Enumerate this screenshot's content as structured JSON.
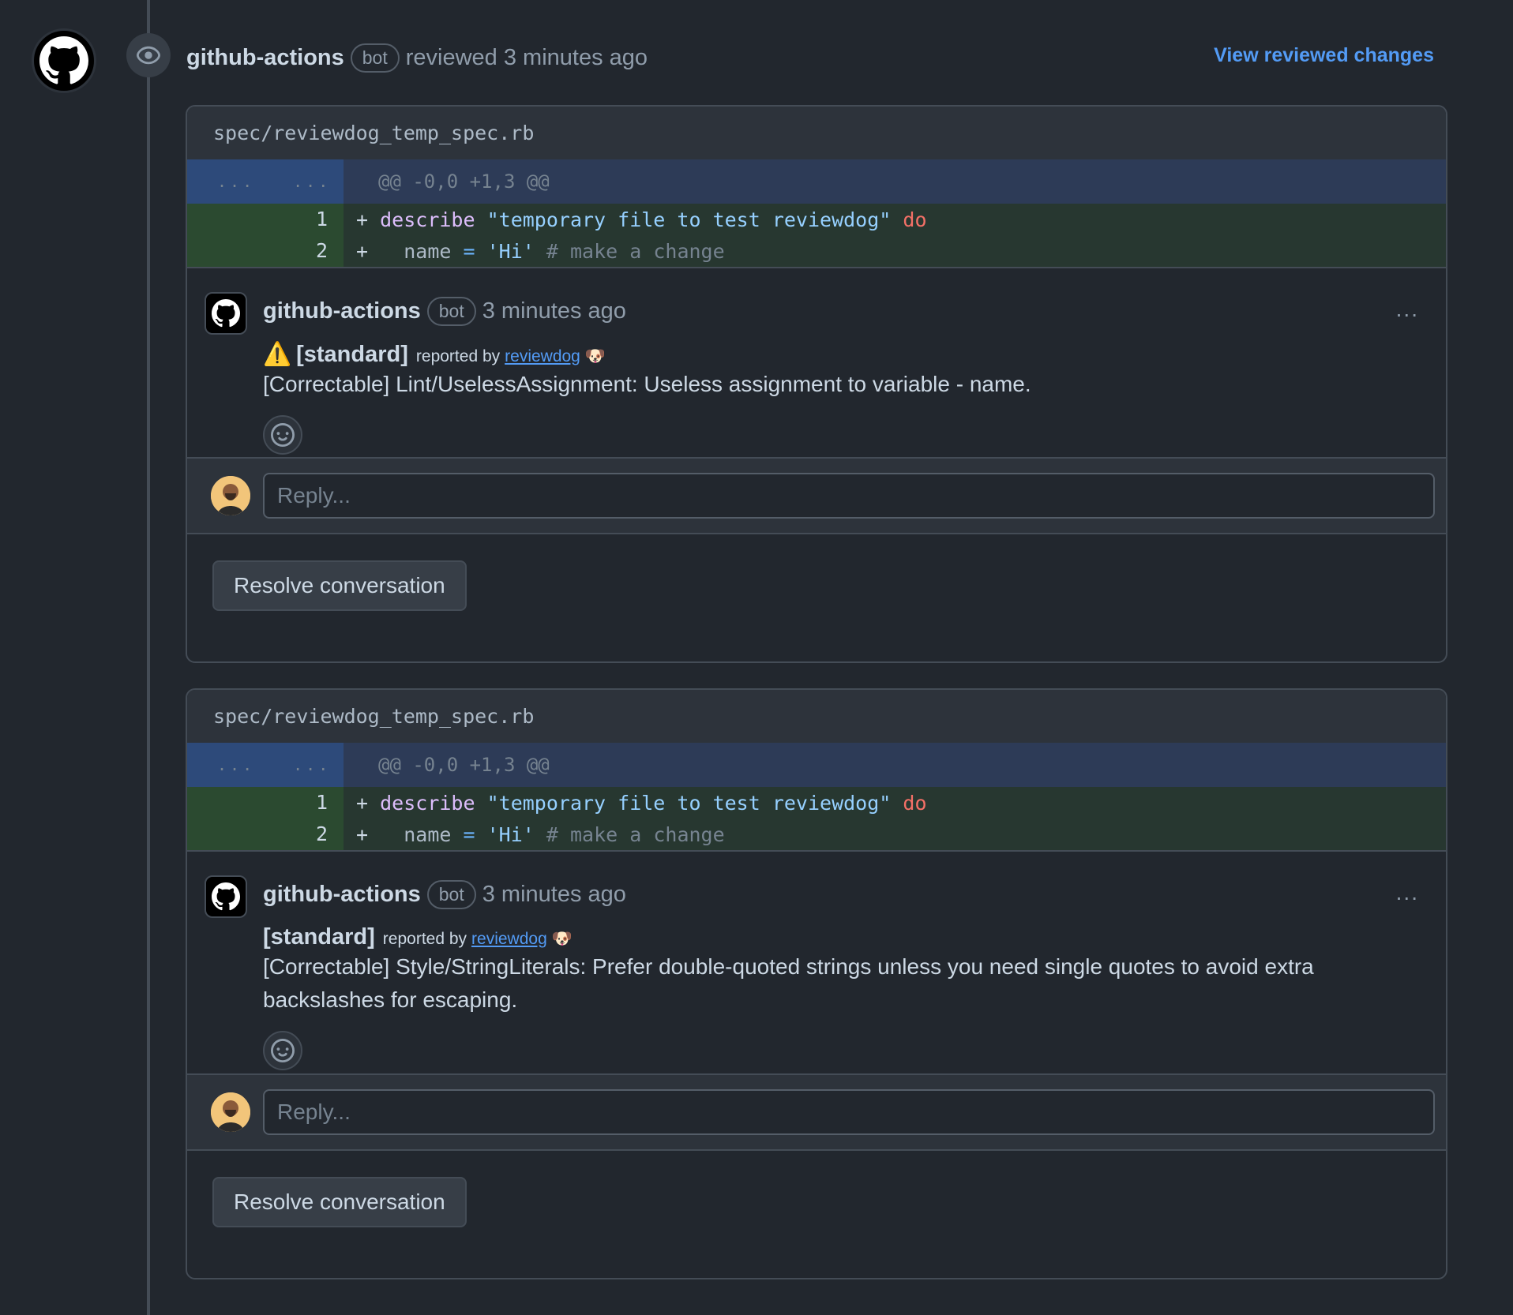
{
  "review": {
    "author": "github-actions",
    "badge": "bot",
    "action": "reviewed 3 minutes ago",
    "view_link": "View reviewed changes"
  },
  "threads": [
    {
      "file": "spec/reviewdog_temp_spec.rb",
      "hunk": {
        "left": "...",
        "right": "...",
        "header": "@@ -0,0 +1,3 @@"
      },
      "lines": [
        {
          "num": "1",
          "sign": "+",
          "tokens": [
            {
              "t": "describe",
              "c": "kw"
            },
            {
              "t": " "
            },
            {
              "t": "\"temporary file to test reviewdog\"",
              "c": "str"
            },
            {
              "t": " "
            },
            {
              "t": "do",
              "c": "red"
            }
          ]
        },
        {
          "num": "2",
          "sign": "+",
          "tokens": [
            {
              "t": "  name "
            },
            {
              "t": "=",
              "c": "op"
            },
            {
              "t": " "
            },
            {
              "t": "'Hi'",
              "c": "str"
            },
            {
              "t": " "
            },
            {
              "t": "# make a change",
              "c": "cm"
            }
          ]
        }
      ],
      "comment": {
        "author": "github-actions",
        "badge": "bot",
        "time": "3 minutes ago",
        "more": "...",
        "warning_icon": "⚠️",
        "tag": "[standard]",
        "reported_by": "reported by",
        "tool_link": "reviewdog",
        "tool_icon": "🐶",
        "body": "[Correctable] Lint/UselessAssignment: Useless assignment to variable - name."
      },
      "reply_placeholder": "Reply...",
      "resolve_label": "Resolve conversation"
    },
    {
      "file": "spec/reviewdog_temp_spec.rb",
      "hunk": {
        "left": "...",
        "right": "...",
        "header": "@@ -0,0 +1,3 @@"
      },
      "lines": [
        {
          "num": "1",
          "sign": "+",
          "tokens": [
            {
              "t": "describe",
              "c": "kw"
            },
            {
              "t": " "
            },
            {
              "t": "\"temporary file to test reviewdog\"",
              "c": "str"
            },
            {
              "t": " "
            },
            {
              "t": "do",
              "c": "red"
            }
          ]
        },
        {
          "num": "2",
          "sign": "+",
          "tokens": [
            {
              "t": "  name "
            },
            {
              "t": "=",
              "c": "op"
            },
            {
              "t": " "
            },
            {
              "t": "'Hi'",
              "c": "str"
            },
            {
              "t": " "
            },
            {
              "t": "# make a change",
              "c": "cm"
            }
          ]
        }
      ],
      "comment": {
        "author": "github-actions",
        "badge": "bot",
        "time": "3 minutes ago",
        "more": "...",
        "tag": "[standard]",
        "reported_by": "reported by",
        "tool_link": "reviewdog",
        "tool_icon": "🐶",
        "body": "[Correctable] Style/StringLiterals: Prefer double-quoted strings unless you need single quotes to avoid extra backslashes for escaping."
      },
      "reply_placeholder": "Reply...",
      "resolve_label": "Resolve conversation"
    }
  ],
  "colors": {
    "background": "#22272e",
    "link": "#539bf5",
    "added_line": "#273730",
    "hunk": "#2d3b57"
  }
}
